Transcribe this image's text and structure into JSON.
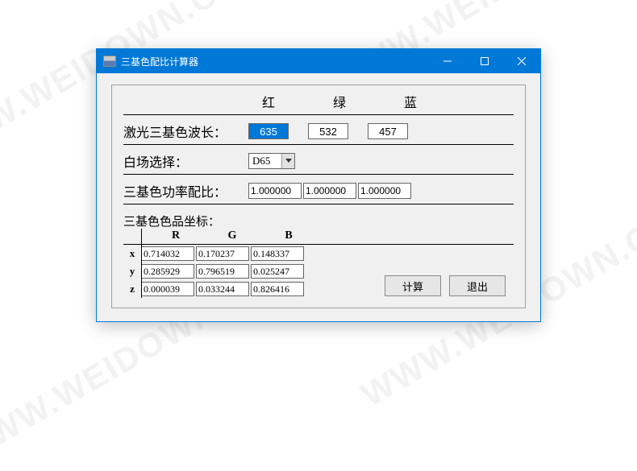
{
  "window": {
    "title": "三基色配比计算器"
  },
  "header_cols": {
    "red": "红",
    "green": "绿",
    "blue": "蓝"
  },
  "wavelength": {
    "label": "激光三基色波长：",
    "red": "635",
    "green": "532",
    "blue": "457"
  },
  "whitepoint": {
    "label": "白场选择：",
    "value": "D65"
  },
  "power_ratio": {
    "label": "三基色功率配比：",
    "r": "1.000000",
    "g": "1.000000",
    "b": "1.000000"
  },
  "chroma": {
    "title": "三基色色品坐标：",
    "cols": {
      "R": "R",
      "G": "G",
      "B": "B"
    },
    "rows": [
      {
        "label": "x",
        "R": "0.714032",
        "G": "0.170237",
        "B": "0.148337"
      },
      {
        "label": "y",
        "R": "0.285929",
        "G": "0.796519",
        "B": "0.025247"
      },
      {
        "label": "z",
        "R": "0.000039",
        "G": "0.033244",
        "B": "0.826416"
      }
    ]
  },
  "buttons": {
    "calc": "计算",
    "exit": "退出"
  }
}
